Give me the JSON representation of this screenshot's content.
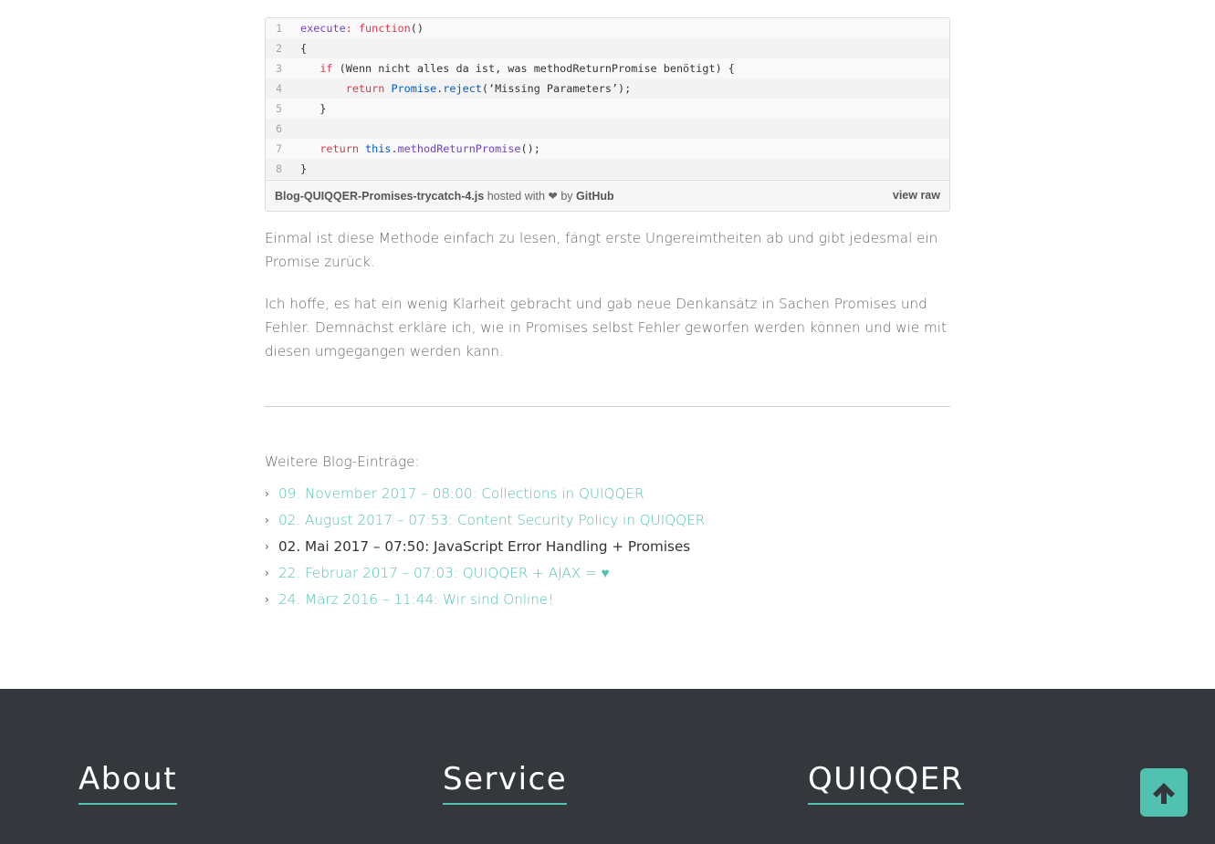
{
  "gist": {
    "lines": [
      {
        "num": "1",
        "parts": [
          {
            "t": "execute",
            "c": "p"
          },
          {
            "t": ": ",
            "c": "k"
          },
          {
            "t": "function",
            "c": "k"
          },
          {
            "t": "()",
            "c": ""
          }
        ]
      },
      {
        "num": "2",
        "parts": [
          {
            "t": "{",
            "c": ""
          }
        ]
      },
      {
        "num": "3",
        "parts": [
          {
            "t": "   ",
            "c": ""
          },
          {
            "t": "if",
            "c": "k"
          },
          {
            "t": " (Wenn nicht alles da ist, was methodReturnPromise benötigt) {",
            "c": ""
          }
        ]
      },
      {
        "num": "4",
        "parts": [
          {
            "t": "       ",
            "c": ""
          },
          {
            "t": "return",
            "c": "k"
          },
          {
            "t": " ",
            "c": ""
          },
          {
            "t": "Promise",
            "c": "b"
          },
          {
            "t": ".",
            "c": ""
          },
          {
            "t": "reject",
            "c": "b"
          },
          {
            "t": "(‘Missing Parameters’);",
            "c": ""
          }
        ]
      },
      {
        "num": "5",
        "parts": [
          {
            "t": "   }",
            "c": ""
          }
        ]
      },
      {
        "num": "6",
        "parts": [
          {
            "t": "",
            "c": ""
          }
        ]
      },
      {
        "num": "7",
        "parts": [
          {
            "t": "   ",
            "c": ""
          },
          {
            "t": "return",
            "c": "k"
          },
          {
            "t": " ",
            "c": ""
          },
          {
            "t": "this",
            "c": "b"
          },
          {
            "t": ".",
            "c": ""
          },
          {
            "t": "methodReturnPromise",
            "c": "p"
          },
          {
            "t": "();",
            "c": ""
          }
        ]
      },
      {
        "num": "8",
        "parts": [
          {
            "t": "}",
            "c": ""
          }
        ]
      }
    ],
    "filename": "Blog-QUIQQER-Promises-trycatch-4.js",
    "hosted_text": " hosted with ❤ by ",
    "github": "GitHub",
    "view_raw": "view raw"
  },
  "article": {
    "paragraph1": "Einmal ist diese Methode einfach zu lesen, fängt erste Ungereimtheiten ab und gibt jedesmal ein Promise zurück.",
    "paragraph2": "Ich hoffe, es hat ein wenig Klarheit gebracht und gab neue Denkansätz in Sachen Promises und Fehler. Demnächst erkläre ich, wie in Promises selbst Fehler geworfen werden können und wie mit diesen umgegangen werden kann."
  },
  "more_entries": {
    "heading": "Weitere Blog-Einträge:",
    "items": [
      {
        "label": "09. November 2017 – 08:00: Collections in QUIQQER",
        "current": false
      },
      {
        "label": "02. August 2017 – 07:53: Content Security Policy in QUIQQER",
        "current": false
      },
      {
        "label": "02. Mai 2017 – 07:50: JavaScript Error Handling + Promises",
        "current": true
      },
      {
        "label": "22. Februar 2017 – 07:03: QUIQQER + AJAX = ♥",
        "current": false
      },
      {
        "label": "24. März 2016 – 11:44: Wir sind Online!",
        "current": false
      }
    ]
  },
  "footer": {
    "about": "About",
    "service": "Service",
    "quiqqer": "QUIQQER"
  },
  "icons": {
    "back_to_top": "arrow-up-icon",
    "list_bullet": "chevron-right-icon"
  },
  "colors": {
    "accent": "#52c2b0",
    "footer_bg": "#34373c"
  }
}
